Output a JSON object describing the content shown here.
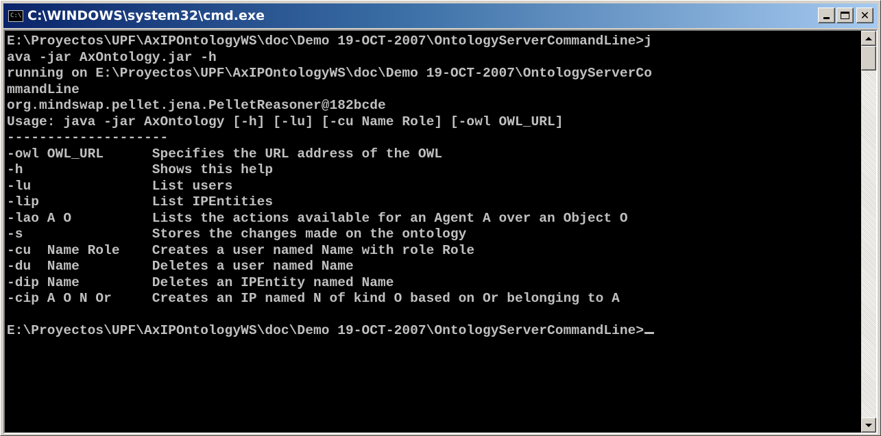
{
  "window": {
    "title": "C:\\WINDOWS\\system32\\cmd.exe",
    "icon": "console-icon",
    "icon_glyph": "C:\\",
    "buttons": {
      "minimize": "minimize-icon",
      "maximize": "maximize-icon",
      "close": "close-icon",
      "close_glyph": "✕"
    }
  },
  "console": {
    "foreground": "#c0c0c0",
    "background": "#000000",
    "lines": [
      "E:\\Proyectos\\UPF\\AxIPOntologyWS\\doc\\Demo 19-OCT-2007\\OntologyServerCommandLine>j",
      "ava -jar AxOntology.jar -h",
      "running on E:\\Proyectos\\UPF\\AxIPOntologyWS\\doc\\Demo 19-OCT-2007\\OntologyServerCo",
      "mmandLine",
      "org.mindswap.pellet.jena.PelletReasoner@182bcde",
      "Usage: java -jar AxOntology [-h] [-lu] [-cu Name Role] [-owl OWL_URL]",
      "--------------------",
      "-owl OWL_URL      Specifies the URL address of the OWL",
      "-h                Shows this help",
      "-lu               List users",
      "-lip              List IPEntities",
      "-lao A O          Lists the actions available for an Agent A over an Object O",
      "-s                Stores the changes made on the ontology",
      "-cu  Name Role    Creates a user named Name with role Role",
      "-du  Name         Deletes a user named Name",
      "-dip Name         Deletes an IPEntity named Name",
      "-cip A O N Or     Creates an IP named N of kind O based on Or belonging to A",
      "",
      "E:\\Proyectos\\UPF\\AxIPOntologyWS\\doc\\Demo 19-OCT-2007\\OntologyServerCommandLine>"
    ]
  },
  "scrollbar": {
    "position": 0,
    "up_icon": "scroll-up-arrow-icon",
    "down_icon": "scroll-down-arrow-icon"
  }
}
